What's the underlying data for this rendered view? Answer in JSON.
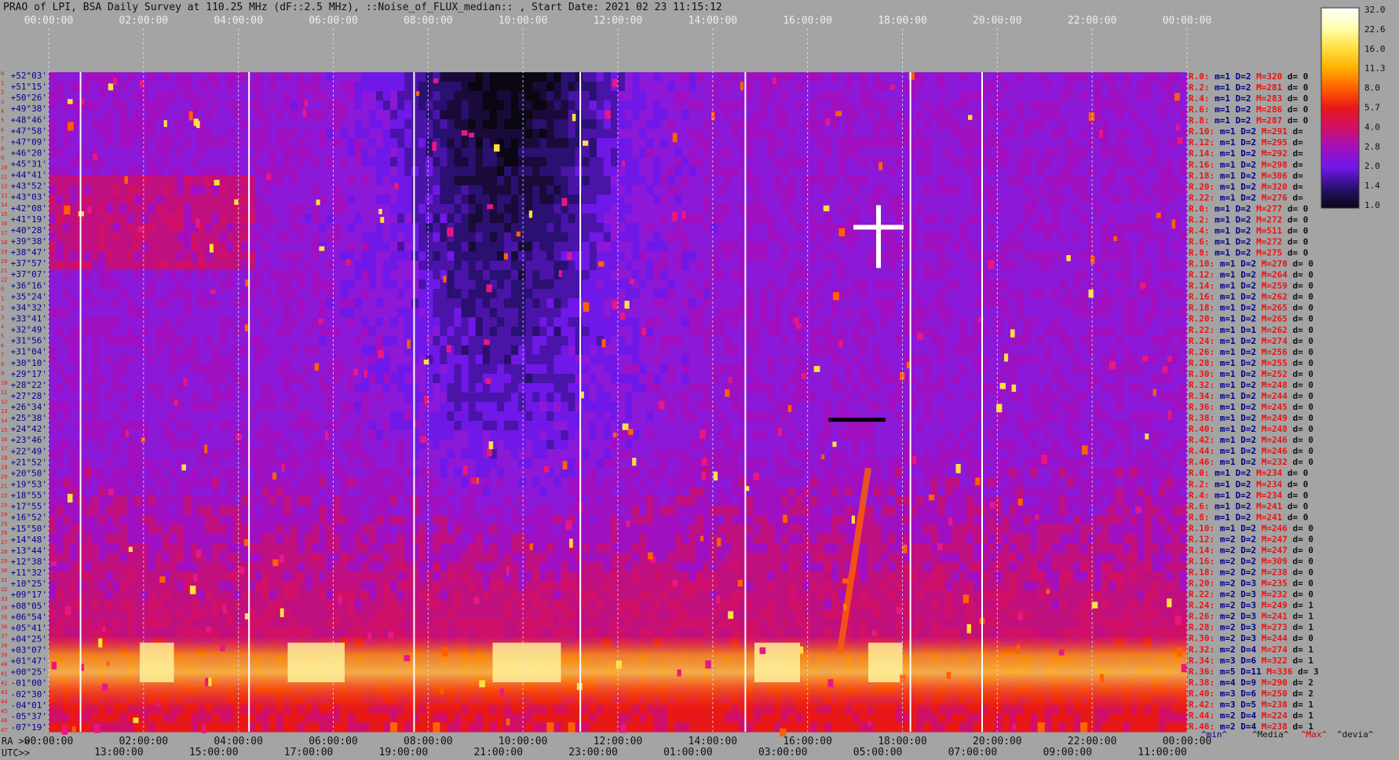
{
  "title": "PRAO of LPI, BSA Daily Survey at 110.25 MHz (dF::2.5 MHz), ::Noise_of_FLUX_median:: , Start Date: 2021 02 23 11:15:12",
  "axis_labels": {
    "ra": "RA >>",
    "utc": "UTC>>"
  },
  "colorbar": {
    "ticks": [
      "32.0",
      "22.6",
      "16.0",
      "11.3",
      "8.0",
      "5.7",
      "4.0",
      "2.8",
      "2.0",
      "1.4",
      "1.0"
    ],
    "stops": [
      "#ffffff",
      "#ffffb0",
      "#ffe040",
      "#ffb000",
      "#ff6000",
      "#e81818",
      "#d01068",
      "#a010c0",
      "#7018e8",
      "#2a1070",
      "#0a0612"
    ]
  },
  "footer_legend": {
    "min": "^min^",
    "median": "^Media^",
    "max": "^Max^",
    "dev": "^devia^"
  },
  "colors": {
    "background": "#a4a4a4",
    "min_text": "#00008b",
    "max_text": "#cc0000",
    "row_text": "#ee1111",
    "dec_text": "#000099"
  },
  "chart_data": {
    "type": "heatmap",
    "x_top_ticks": [
      "00:00:00",
      "02:00:00",
      "04:00:00",
      "06:00:00",
      "08:00:00",
      "10:00:00",
      "12:00:00",
      "14:00:00",
      "16:00:00",
      "18:00:00",
      "20:00:00",
      "22:00:00",
      "00:00:00"
    ],
    "x_bottom_ra_ticks": [
      "00:00:00",
      "02:00:00",
      "04:00:00",
      "06:00:00",
      "08:00:00",
      "10:00:00",
      "12:00:00",
      "14:00:00",
      "16:00:00",
      "18:00:00",
      "20:00:00",
      "22:00:00",
      "00:00:00"
    ],
    "x_bottom_utc_ticks": [
      "13:00:00",
      "15:00:00",
      "17:00:00",
      "19:00:00",
      "21:00:00",
      "23:00:00",
      "01:00:00",
      "03:00:00",
      "05:00:00",
      "07:00:00",
      "09:00:00",
      "11:00:00"
    ],
    "declination_labels": [
      "+52°03'",
      "+51°15'",
      "+50°26'",
      "+49°38'",
      "+48°46'",
      "+47°58'",
      "+47°09'",
      "+46°20'",
      "+45°31'",
      "+44°41'",
      "+43°52'",
      "+43°03'",
      "+42°08'",
      "+41°19'",
      "+40°28'",
      "+39°38'",
      "+38°47'",
      "+37°57'",
      "+37°07'",
      "+36°16'",
      "+35°24'",
      "+34°32'",
      "+33°41'",
      "+32°49'",
      "+31°56'",
      "+31°04'",
      "+30°10'",
      "+29°17'",
      "+28°22'",
      "+27°28'",
      "+26°34'",
      "+25°38'",
      "+24°42'",
      "+23°46'",
      "+22°49'",
      "+21°52'",
      "+20°50'",
      "+19°53'",
      "+18°55'",
      "+17°55'",
      "+16°52'",
      "+15°50'",
      "+14°48'",
      "+13°44'",
      "+12°38'",
      "+11°32'",
      "+10°25'",
      "+09°17'",
      "+08°05'",
      "+06°54'",
      "+05°41'",
      "+04°25'",
      "+03°07'",
      "+01°47'",
      "+00°25'",
      "-01°00'",
      "-02°30'",
      "-04°01'",
      "-05°37'",
      "-07°19'"
    ],
    "row_numbers": [
      "0",
      "1",
      "2",
      "3",
      "4",
      "5",
      "6",
      "7",
      "8",
      "9",
      "10",
      "11",
      "12",
      "13",
      "14",
      "15",
      "16",
      "17",
      "18",
      "19",
      "20",
      "21",
      "22",
      "0",
      "1",
      "2",
      "3",
      "4",
      "5",
      "6",
      "7",
      "8",
      "9",
      "10",
      "11",
      "12",
      "13",
      "14",
      "15",
      "16",
      "17",
      "18",
      "19",
      "20",
      "21",
      "22",
      "23",
      "24",
      "25",
      "26",
      "27",
      "28",
      "29",
      "30",
      "31",
      "32",
      "33",
      "34",
      "35",
      "36",
      "37",
      "38",
      "39",
      "40",
      "41",
      "42",
      "43",
      "44",
      "45",
      "46",
      "47"
    ],
    "stats_rows": [
      {
        "r": "R.0:",
        "m": "m=1",
        "d": "D=2",
        "max": "M=320",
        "dev": "d= 0"
      },
      {
        "r": "R.2:",
        "m": "m=1",
        "d": "D=2",
        "max": "M=281",
        "dev": "d= 0"
      },
      {
        "r": "R.4:",
        "m": "m=1",
        "d": "D=2",
        "max": "M=283",
        "dev": "d= 0"
      },
      {
        "r": "R.6:",
        "m": "m=1",
        "d": "D=2",
        "max": "M=286",
        "dev": "d= 0"
      },
      {
        "r": "R.8:",
        "m": "m=1",
        "d": "D=2",
        "max": "M=287",
        "dev": "d= 0"
      },
      {
        "r": "R.10:",
        "m": "m=1",
        "d": "D=2",
        "max": "M=291",
        "dev": "d="
      },
      {
        "r": "R.12:",
        "m": "m=1",
        "d": "D=2",
        "max": "M=295",
        "dev": "d="
      },
      {
        "r": "R.14:",
        "m": "m=1",
        "d": "D=2",
        "max": "M=292",
        "dev": "d="
      },
      {
        "r": "R.16:",
        "m": "m=1",
        "d": "D=2",
        "max": "M=298",
        "dev": "d="
      },
      {
        "r": "R.18:",
        "m": "m=1",
        "d": "D=2",
        "max": "M=306",
        "dev": "d="
      },
      {
        "r": "R.20:",
        "m": "m=1",
        "d": "D=2",
        "max": "M=320",
        "dev": "d="
      },
      {
        "r": "R.22:",
        "m": "m=1",
        "d": "D=2",
        "max": "M=276",
        "dev": "d="
      },
      {
        "r": "R.0:",
        "m": "m=1",
        "d": "D=2",
        "max": "M=277",
        "dev": "d= 0"
      },
      {
        "r": "R.2:",
        "m": "m=1",
        "d": "D=2",
        "max": "M=272",
        "dev": "d= 0"
      },
      {
        "r": "R.4:",
        "m": "m=1",
        "d": "D=2",
        "max": "M=511",
        "dev": "d= 0"
      },
      {
        "r": "R.6:",
        "m": "m=1",
        "d": "D=2",
        "max": "M=272",
        "dev": "d= 0"
      },
      {
        "r": "R.8:",
        "m": "m=1",
        "d": "D=2",
        "max": "M=275",
        "dev": "d= 0"
      },
      {
        "r": "R.10:",
        "m": "m=1",
        "d": "D=2",
        "max": "M=270",
        "dev": "d= 0"
      },
      {
        "r": "R.12:",
        "m": "m=1",
        "d": "D=2",
        "max": "M=264",
        "dev": "d= 0"
      },
      {
        "r": "R.14:",
        "m": "m=1",
        "d": "D=2",
        "max": "M=259",
        "dev": "d= 0"
      },
      {
        "r": "R.16:",
        "m": "m=1",
        "d": "D=2",
        "max": "M=262",
        "dev": "d= 0"
      },
      {
        "r": "R.18:",
        "m": "m=1",
        "d": "D=2",
        "max": "M=265",
        "dev": "d= 0"
      },
      {
        "r": "R.20:",
        "m": "m=1",
        "d": "D=2",
        "max": "M=265",
        "dev": "d= 0"
      },
      {
        "r": "R.22:",
        "m": "m=1",
        "d": "D=1",
        "max": "M=262",
        "dev": "d= 0"
      },
      {
        "r": "R.24:",
        "m": "m=1",
        "d": "D=2",
        "max": "M=274",
        "dev": "d= 0"
      },
      {
        "r": "R.26:",
        "m": "m=1",
        "d": "D=2",
        "max": "M=256",
        "dev": "d= 0"
      },
      {
        "r": "R.28:",
        "m": "m=1",
        "d": "D=2",
        "max": "M=255",
        "dev": "d= 0"
      },
      {
        "r": "R.30:",
        "m": "m=1",
        "d": "D=2",
        "max": "M=252",
        "dev": "d= 0"
      },
      {
        "r": "R.32:",
        "m": "m=1",
        "d": "D=2",
        "max": "M=248",
        "dev": "d= 0"
      },
      {
        "r": "R.34:",
        "m": "m=1",
        "d": "D=2",
        "max": "M=244",
        "dev": "d= 0"
      },
      {
        "r": "R.36:",
        "m": "m=1",
        "d": "D=2",
        "max": "M=245",
        "dev": "d= 0"
      },
      {
        "r": "R.38:",
        "m": "m=1",
        "d": "D=2",
        "max": "M=249",
        "dev": "d= 0"
      },
      {
        "r": "R.40:",
        "m": "m=1",
        "d": "D=2",
        "max": "M=248",
        "dev": "d= 0"
      },
      {
        "r": "R.42:",
        "m": "m=1",
        "d": "D=2",
        "max": "M=246",
        "dev": "d= 0"
      },
      {
        "r": "R.44:",
        "m": "m=1",
        "d": "D=2",
        "max": "M=246",
        "dev": "d= 0"
      },
      {
        "r": "R.46:",
        "m": "m=1",
        "d": "D=2",
        "max": "M=232",
        "dev": "d= 0"
      },
      {
        "r": "R.0:",
        "m": "m=1",
        "d": "D=2",
        "max": "M=234",
        "dev": "d= 0"
      },
      {
        "r": "R.2:",
        "m": "m=1",
        "d": "D=2",
        "max": "M=234",
        "dev": "d= 0"
      },
      {
        "r": "R.4:",
        "m": "m=1",
        "d": "D=2",
        "max": "M=234",
        "dev": "d= 0"
      },
      {
        "r": "R.6:",
        "m": "m=1",
        "d": "D=2",
        "max": "M=241",
        "dev": "d= 0"
      },
      {
        "r": "R.8:",
        "m": "m=1",
        "d": "D=2",
        "max": "M=241",
        "dev": "d= 0"
      },
      {
        "r": "R.10:",
        "m": "m=1",
        "d": "D=2",
        "max": "M=246",
        "dev": "d= 0"
      },
      {
        "r": "R.12:",
        "m": "m=2",
        "d": "D=2",
        "max": "M=247",
        "dev": "d= 0"
      },
      {
        "r": "R.14:",
        "m": "m=2",
        "d": "D=2",
        "max": "M=247",
        "dev": "d= 0"
      },
      {
        "r": "R.16:",
        "m": "m=2",
        "d": "D=2",
        "max": "M=309",
        "dev": "d= 0"
      },
      {
        "r": "R.18:",
        "m": "m=2",
        "d": "D=2",
        "max": "M=238",
        "dev": "d= 0"
      },
      {
        "r": "R.20:",
        "m": "m=2",
        "d": "D=3",
        "max": "M=235",
        "dev": "d= 0"
      },
      {
        "r": "R.22:",
        "m": "m=2",
        "d": "D=3",
        "max": "M=232",
        "dev": "d= 0"
      },
      {
        "r": "R.24:",
        "m": "m=2",
        "d": "D=3",
        "max": "M=249",
        "dev": "d= 1"
      },
      {
        "r": "R.26:",
        "m": "m=2",
        "d": "D=3",
        "max": "M=241",
        "dev": "d= 1"
      },
      {
        "r": "R.28:",
        "m": "m=2",
        "d": "D=3",
        "max": "M=273",
        "dev": "d= 1"
      },
      {
        "r": "R.30:",
        "m": "m=2",
        "d": "D=3",
        "max": "M=244",
        "dev": "d= 0"
      },
      {
        "r": "R.32:",
        "m": "m=2",
        "d": "D=4",
        "max": "M=274",
        "dev": "d= 1"
      },
      {
        "r": "R.34:",
        "m": "m=3",
        "d": "D=6",
        "max": "M=322",
        "dev": "d= 1"
      },
      {
        "r": "R.36:",
        "m": "m=5",
        "d": "D=11",
        "max": "M=336",
        "dev": "d= 3"
      },
      {
        "r": "R.38:",
        "m": "m=4",
        "d": "D=9",
        "max": "M=290",
        "dev": "d= 2"
      },
      {
        "r": "R.40:",
        "m": "m=3",
        "d": "D=6",
        "max": "M=250",
        "dev": "d= 2"
      },
      {
        "r": "R.42:",
        "m": "m=3",
        "d": "D=5",
        "max": "M=238",
        "dev": "d= 1"
      },
      {
        "r": "R.44:",
        "m": "m=2",
        "d": "D=4",
        "max": "M=224",
        "dev": "d= 1"
      },
      {
        "r": "R.46:",
        "m": "m=2",
        "d": "D=4",
        "max": "M=238",
        "dev": "d= 1"
      }
    ]
  }
}
